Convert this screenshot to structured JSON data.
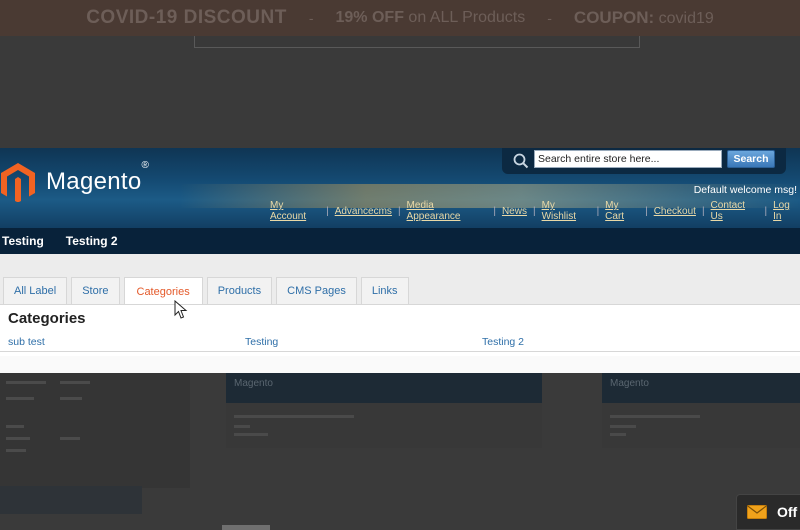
{
  "promo": {
    "title": "COVID-19 DISCOUNT",
    "sep1": "-",
    "discount_bold": "19% OFF",
    "discount_rest": "on ALL Products",
    "sep2": "-",
    "coupon_label": "COUPON:",
    "coupon_code": "covid19"
  },
  "magento": {
    "logo_text": "Magento",
    "logo_reg": "®",
    "search": {
      "placeholder": "Search entire store here...",
      "button": "Search"
    },
    "welcome": "Default welcome msg!",
    "links": [
      "My Account",
      "Advancecms",
      "Media Appearance",
      "News",
      "My Wishlist",
      "My Cart",
      "Checkout",
      "Contact Us",
      "Log In"
    ],
    "nav": [
      "Testing",
      "Testing 2"
    ],
    "tabs": [
      "All Label",
      "Store",
      "Categories",
      "Products",
      "CMS Pages",
      "Links"
    ],
    "active_tab": "Categories",
    "panel_title": "Categories",
    "categories": [
      "sub test",
      "Testing",
      "Testing 2"
    ]
  },
  "thumbs": {
    "mid_logo": "Magento",
    "right_logo": "Magento"
  },
  "chat": {
    "label": "Off"
  },
  "colors": {
    "accent_orange": "#e45a2b",
    "link_blue": "#2f6fa8",
    "header_blue": "#144a72"
  }
}
